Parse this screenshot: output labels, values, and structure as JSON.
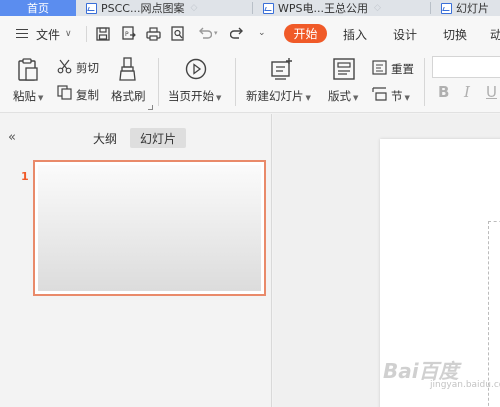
{
  "tabs": {
    "home": "首页",
    "tab1": "PSCC...网点图案",
    "tab2": "WPS电...王总公用",
    "tab3": "幻灯片"
  },
  "menu": {
    "file": "文件",
    "start": "开始",
    "insert": "插入",
    "design": "设计",
    "transition": "切换",
    "animation": "动"
  },
  "ribbon": {
    "paste": "粘贴",
    "cut": "剪切",
    "copy": "复制",
    "format_painter": "格式刷",
    "from_current": "当页开始",
    "new_slide": "新建幻灯片",
    "layout": "版式",
    "reset": "重置",
    "section": "节",
    "bold": "B",
    "italic": "I",
    "underline": "U"
  },
  "panel": {
    "collapse": "«",
    "outline": "大纲",
    "slides": "幻灯片",
    "slide_number": "1"
  },
  "watermark": {
    "brand": "Bai百度",
    "sub": "jingyan.baidu.com"
  },
  "colors": {
    "accent": "#f05a28",
    "home_tab": "#5b8def"
  }
}
